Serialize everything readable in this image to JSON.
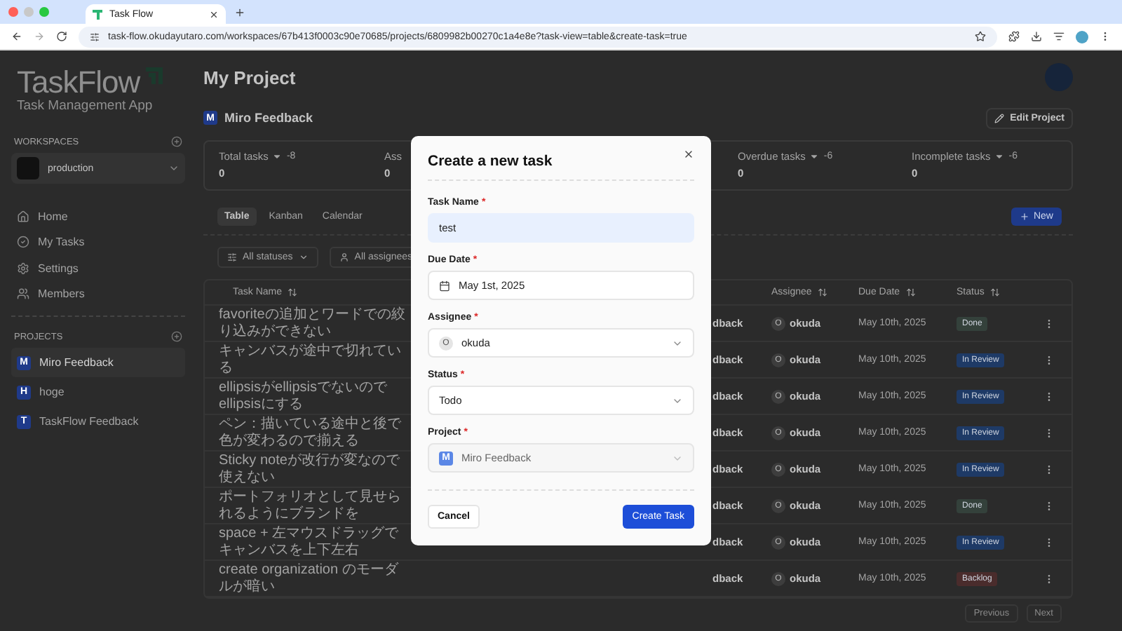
{
  "browser": {
    "tab_title": "Task Flow",
    "url": "task-flow.okudayutaro.com/workspaces/67b413f0003c90e70685/projects/6809982b00270c1a4e8e?task-view=table&create-task=true"
  },
  "sidebar": {
    "logo_title": "TaskFlow",
    "logo_subtitle": "Task Management App",
    "workspaces_heading": "WORKSPACES",
    "workspace": "production",
    "nav": [
      {
        "label": "Home",
        "kind": "home"
      },
      {
        "label": "My Tasks",
        "kind": "tasks"
      },
      {
        "label": "Settings",
        "kind": "settings"
      },
      {
        "label": "Members",
        "kind": "members"
      }
    ],
    "projects_heading": "PROJECTS",
    "projects": [
      {
        "initial": "M",
        "name": "Miro Feedback",
        "selected": true
      },
      {
        "initial": "H",
        "name": "hoge",
        "selected": false
      },
      {
        "initial": "T",
        "name": "TaskFlow Feedback",
        "selected": false
      }
    ]
  },
  "header": {
    "title": "My Project",
    "project_initial": "M",
    "project_name": "Miro Feedback",
    "edit_button": "Edit Project"
  },
  "stats": [
    {
      "label": "Total tasks",
      "delta": "-8",
      "value": "0"
    },
    {
      "label": "Ass",
      "value": "0"
    },
    {
      "label": "Overdue tasks",
      "delta": "-6",
      "value": "0"
    },
    {
      "label": "Incomplete tasks",
      "delta": "-6",
      "value": "0"
    }
  ],
  "view_tabs": [
    {
      "label": "Table",
      "selected": true
    },
    {
      "label": "Kanban",
      "selected": false
    },
    {
      "label": "Calendar",
      "selected": false
    }
  ],
  "filters": [
    {
      "label": "All statuses",
      "kind": "status"
    },
    {
      "label": "All assignees",
      "kind": "assignee"
    }
  ],
  "new_button": "New",
  "table": {
    "columns": [
      "Task Name",
      "Assignee",
      "Due Date",
      "Status"
    ],
    "rows": [
      {
        "task": "favoriteの追加とワードでの絞り込みができない",
        "project": "dback",
        "assignee_initial": "O",
        "assignee": "okuda",
        "due": "May 10th, 2025",
        "status": "Done",
        "color": "#34413b"
      },
      {
        "task": "キャンバスが途中で切れている",
        "project": "dback",
        "assignee_initial": "O",
        "assignee": "okuda",
        "due": "May 10th, 2025",
        "status": "In Review",
        "color": "#1e3a66"
      },
      {
        "task": "ellipsisがellipsisでないのでellipsisにする",
        "project": "dback",
        "assignee_initial": "O",
        "assignee": "okuda",
        "due": "May 10th, 2025",
        "status": "In Review",
        "color": "#1e3a66"
      },
      {
        "task": "ペン：描いている途中と後で色が変わるので揃える",
        "project": "dback",
        "assignee_initial": "O",
        "assignee": "okuda",
        "due": "May 10th, 2025",
        "status": "In Review",
        "color": "#1e3a66"
      },
      {
        "task": "Sticky noteが改行が変なので使えない",
        "project": "dback",
        "assignee_initial": "O",
        "assignee": "okuda",
        "due": "May 10th, 2025",
        "status": "In Review",
        "color": "#1e3a66"
      },
      {
        "task": "ポートフォリオとして見せられるようにブランドを",
        "project": "dback",
        "assignee_initial": "O",
        "assignee": "okuda",
        "due": "May 10th, 2025",
        "status": "Done",
        "color": "#34413b"
      },
      {
        "task": "space + 左マウスドラッグでキャンバスを上下左右",
        "project": "dback",
        "assignee_initial": "O",
        "assignee": "okuda",
        "due": "May 10th, 2025",
        "status": "In Review",
        "color": "#1e3a66"
      },
      {
        "task": "create organization のモーダルが暗い",
        "project": "dback",
        "assignee_initial": "O",
        "assignee": "okuda",
        "due": "May 10th, 2025",
        "status": "Backlog",
        "color": "#4a2c2c"
      }
    ]
  },
  "pagination": {
    "previous": "Previous",
    "next": "Next",
    "disabled": true
  },
  "modal": {
    "title": "Create a new task",
    "fields": [
      {
        "label": "Task Name",
        "required_mark": "*",
        "kind": "text",
        "value": "test",
        "autofilled": true,
        "disabled": false
      },
      {
        "label": "Due Date",
        "required_mark": "*",
        "kind": "date",
        "value": "May 1st, 2025",
        "autofilled": false,
        "disabled": false
      },
      {
        "label": "Assignee",
        "required_mark": "*",
        "kind": "assignee",
        "initial": "O",
        "value": "okuda",
        "autofilled": false,
        "disabled": false
      },
      {
        "label": "Status",
        "required_mark": "*",
        "kind": "select",
        "value": "Todo",
        "autofilled": false,
        "disabled": false
      },
      {
        "label": "Project",
        "required_mark": "*",
        "kind": "project",
        "initial": "M",
        "value": "Miro Feedback",
        "autofilled": false,
        "disabled": true
      }
    ],
    "cancel": "Cancel",
    "submit": "Create Task"
  }
}
